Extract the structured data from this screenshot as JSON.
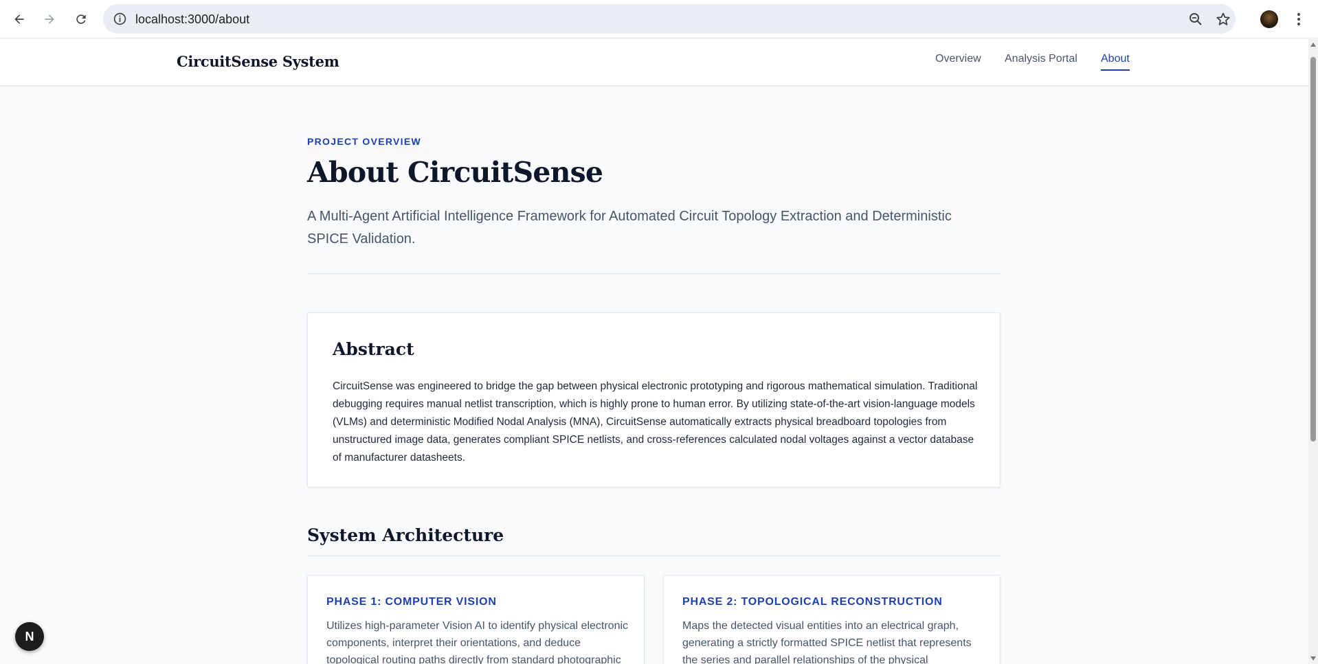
{
  "browser": {
    "url": "localhost:3000/about",
    "icons": [
      "back-icon",
      "forward-icon",
      "reload-icon",
      "info-icon",
      "zoom-icon",
      "star-icon",
      "menu-icon"
    ]
  },
  "site": {
    "brand": "CircuitSense System",
    "nav": [
      "Overview",
      "Analysis Portal",
      "About"
    ],
    "active_nav": "About",
    "accent": "#1e40af"
  },
  "hero": {
    "eyebrow": "PROJECT OVERVIEW",
    "title": "About CircuitSense",
    "subtitle": "A Multi-Agent Artificial Intelligence Framework for Automated Circuit Topology Extraction and Deterministic SPICE Validation."
  },
  "abstract": {
    "title": "Abstract",
    "body": "CircuitSense was engineered to bridge the gap between physical electronic prototyping and rigorous mathematical simulation. Traditional debugging requires manual netlist transcription, which is highly prone to human error. By utilizing state-of-the-art vision-language models (VLMs) and deterministic Modified Nodal Analysis (MNA), CircuitSense automatically extracts physical breadboard topologies from unstructured image data, generates compliant SPICE netlists, and cross-references calculated nodal voltages against a vector database of manufacturer datasheets."
  },
  "architecture": {
    "title": "System Architecture",
    "phases": [
      {
        "title": "PHASE 1: COMPUTER VISION",
        "body": "Utilizes high-parameter Vision AI to identify physical electronic components, interpret their orientations, and deduce topological routing paths directly from standard photographic"
      },
      {
        "title": "PHASE 2: TOPOLOGICAL RECONSTRUCTION",
        "body": "Maps the detected visual entities into an electrical graph, generating a strictly formatted SPICE netlist that represents the series and parallel relationships of the physical"
      }
    ]
  },
  "badge": {
    "letter": "N"
  }
}
